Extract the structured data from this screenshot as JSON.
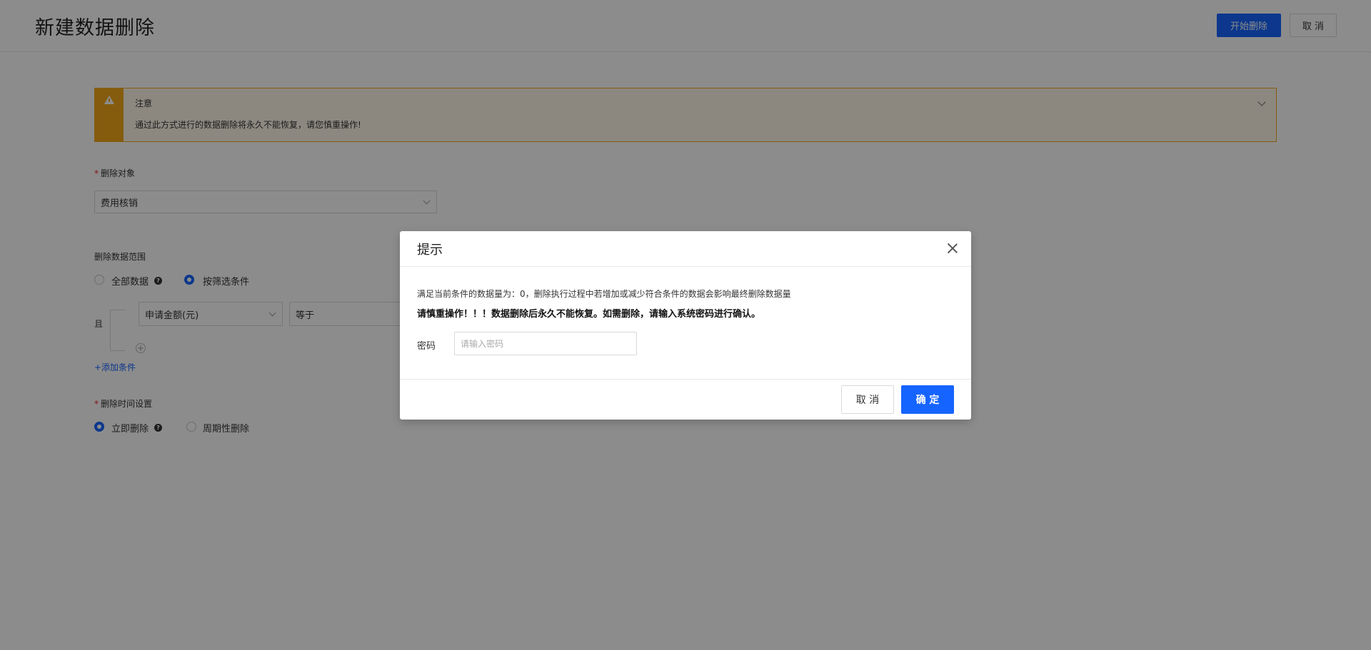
{
  "header": {
    "title": "新建数据删除",
    "start_button": "开始删除",
    "cancel_button": "取 消"
  },
  "alert": {
    "title": "注意",
    "text": "通过此方式进行的数据删除将永久不能恢复，请您慎重操作!"
  },
  "form": {
    "target_label": "删除对象",
    "target_value": "费用核销",
    "range_label": "删除数据范围",
    "range_options": [
      "全部数据",
      "按筛选条件"
    ],
    "range_selected": "按筛选条件",
    "condition_connector": "且",
    "condition_field": "申请金额(元)",
    "condition_operator": "等于",
    "add_condition": "+添加条件",
    "time_label": "删除时间设置",
    "time_options": [
      "立即删除",
      "周期性删除"
    ],
    "time_selected": "立即删除"
  },
  "modal": {
    "title": "提示",
    "line1": "满足当前条件的数据量为：0，删除执行过程中若增加或减少符合条件的数据会影响最终删除数据量",
    "line2": "请慎重操作！！！数据删除后永久不能恢复。如需删除，请输入系统密码进行确认。",
    "password_label": "密码",
    "password_placeholder": "请输入密码",
    "cancel_button": "取 消",
    "ok_button": "确 定"
  },
  "colors": {
    "primary": "#1664ff",
    "warning": "#f3a81b",
    "overlay": "rgba(0,0,0,0.45)"
  }
}
